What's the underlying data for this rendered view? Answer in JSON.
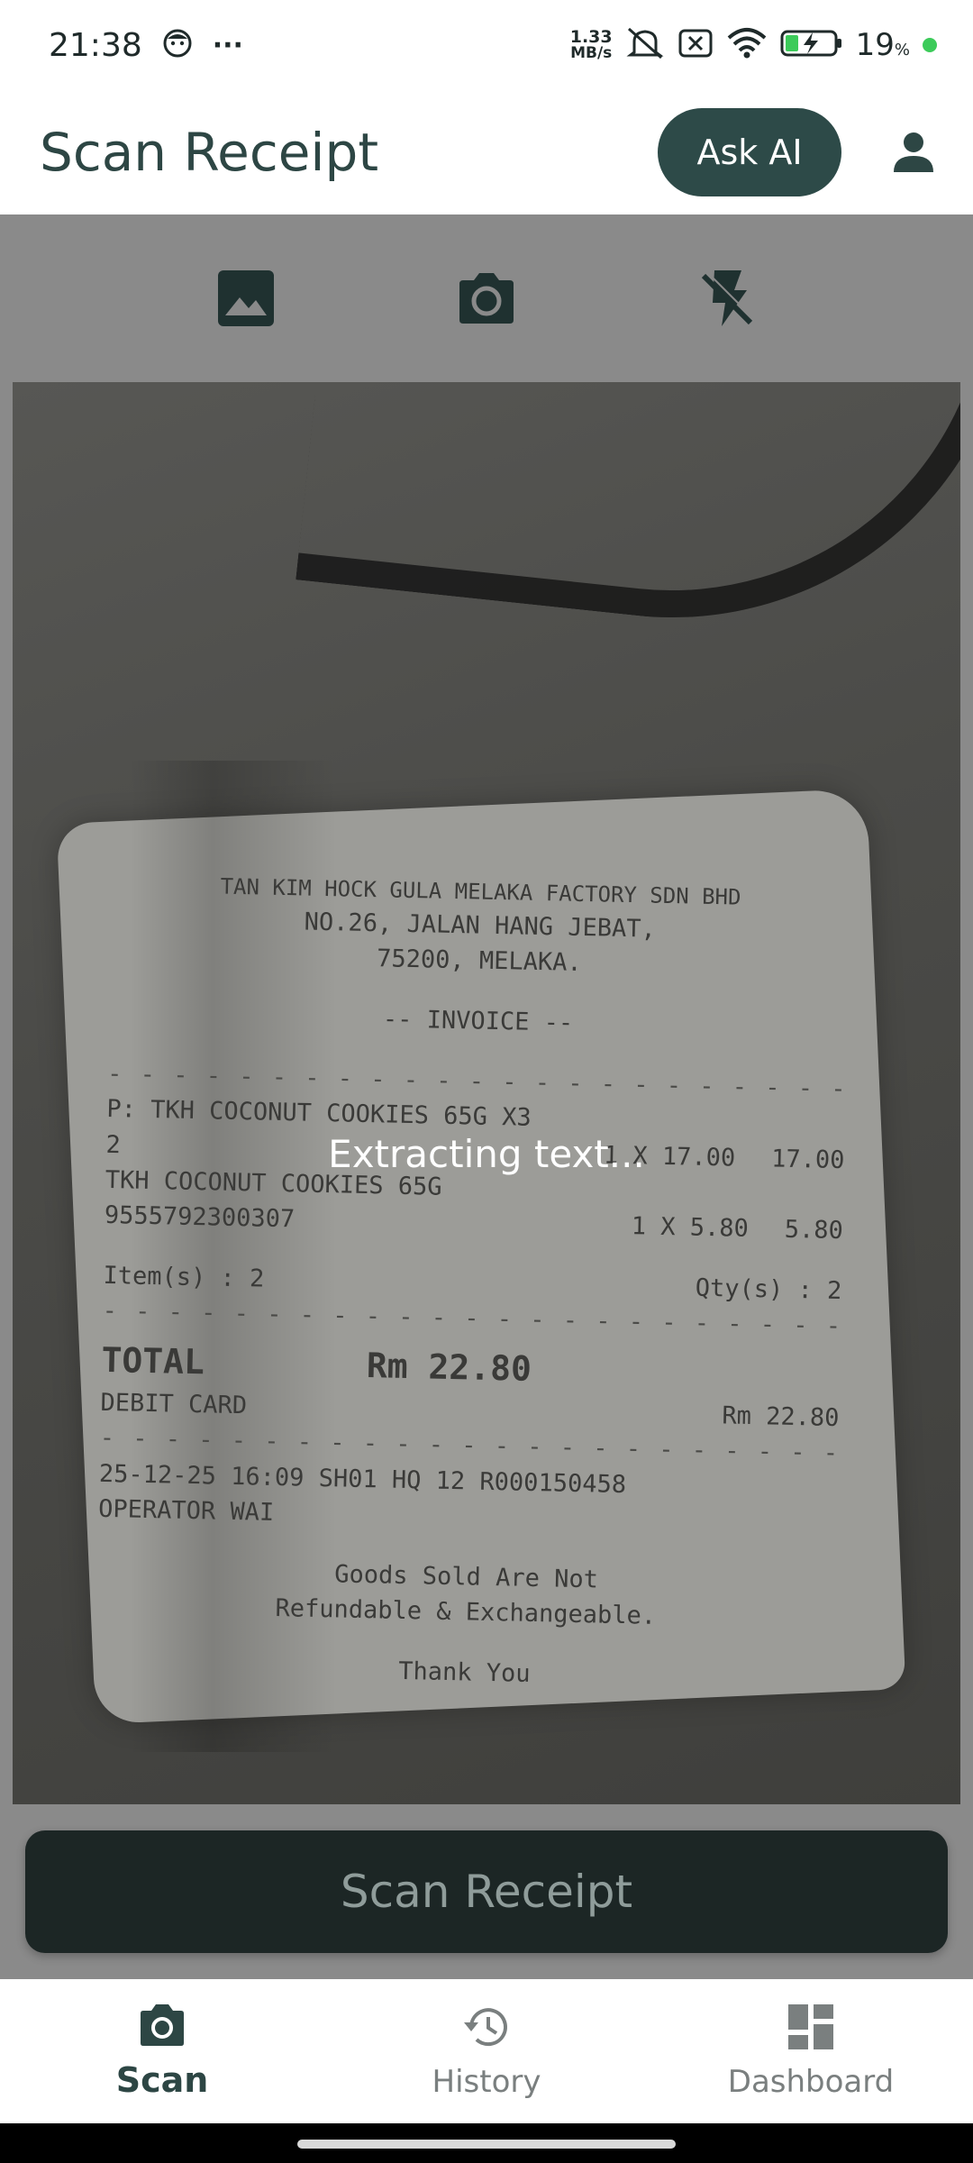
{
  "status_bar": {
    "time": "21:38",
    "more_indicator": "···",
    "net_speed_value": "1.33",
    "net_speed_unit": "MB/s",
    "battery_percent": "19",
    "battery_percent_sign": "%",
    "icons": [
      "face-icon",
      "mute-icon",
      "no-sim-icon",
      "wifi-icon",
      "battery-charging-icon"
    ]
  },
  "app_bar": {
    "title": "Scan Receipt",
    "ask_ai_label": "Ask AI",
    "profile_icon": "person-icon"
  },
  "camera_toolbar": {
    "icons": [
      "gallery-icon",
      "camera-icon",
      "flash-off-icon"
    ]
  },
  "preview": {
    "status_text": "Extracting text...",
    "receipt_lines": {
      "header1": "TAN KIM HOCK GULA MELAKA FACTORY SDN BHD",
      "header2": "NO.26, JALAN HANG JEBAT,",
      "header3": "75200, MELAKA.",
      "doc_type": "-- INVOICE --",
      "item1_name": "P: TKH COCONUT COOKIES 65G X3",
      "item1_code": "2",
      "item1_qty_price": "1 X 17.00",
      "item1_amount": "17.00",
      "item2_name": "TKH COCONUT COOKIES 65G",
      "item2_code": "9555792300307",
      "item2_qty_price": "1 X 5.80",
      "item2_amount": "5.80",
      "items_count": "Item(s) : 2",
      "qty_count": "Qty(s) : 2",
      "total_label": "TOTAL",
      "total_value": "Rm 22.80",
      "payment_method": "DEBIT CARD",
      "payment_amount": "Rm 22.80",
      "txn_line": "25-12-25 16:09 SH01   HQ   12 R000150458",
      "operator": "OPERATOR WAI",
      "policy1": "Goods Sold Are Not",
      "policy2": "Refundable & Exchangeable.",
      "thanks": "Thank You"
    }
  },
  "scan_button_label": "Scan Receipt",
  "bottom_nav": {
    "items": [
      {
        "label": "Scan",
        "icon": "camera-icon",
        "active": true
      },
      {
        "label": "History",
        "icon": "history-icon",
        "active": false
      },
      {
        "label": "Dashboard",
        "icon": "dashboard-icon",
        "active": false
      }
    ]
  },
  "colors": {
    "primary": "#2d4a48",
    "overlay": "#8a8a8a",
    "scan_button_bg": "#1c2625",
    "battery_dot": "#3ccb5a"
  }
}
